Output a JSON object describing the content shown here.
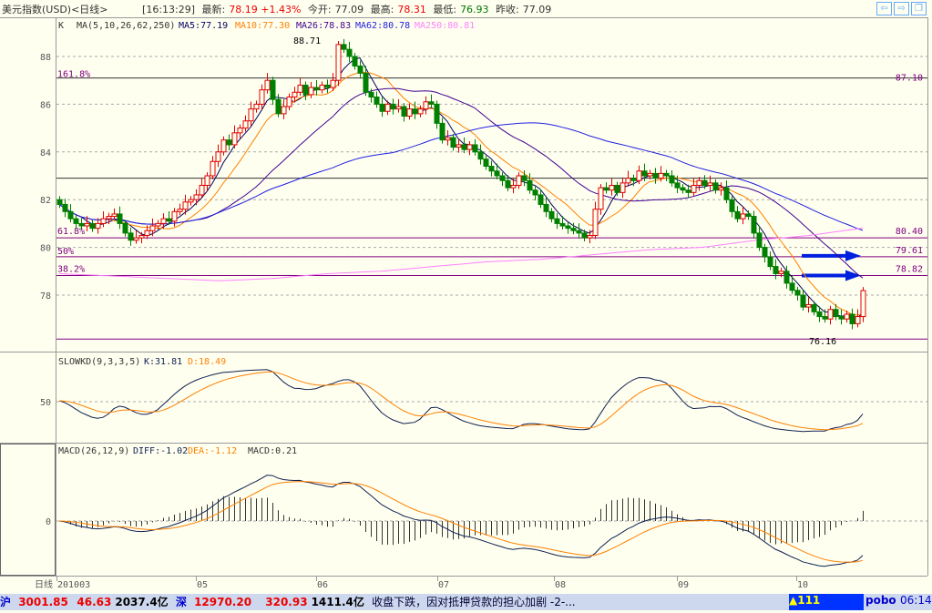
{
  "header": {
    "title": "美元指数(USD)<日线>",
    "time": "[16:13:29]",
    "latest_label": "最新:",
    "latest": "78.19 +1.43%",
    "open_label": "今开:",
    "open": "77.09",
    "high_label": "最高:",
    "high": "78.31",
    "low_label": "最低:",
    "low": "76.93",
    "prev_label": "昨收:",
    "prev": "77.09"
  },
  "nav": {
    "back": "⇦",
    "forward": "⇨",
    "restore": "❐"
  },
  "ma_legend": {
    "k": "K",
    "ma": "MA(5,10,26,62,250)",
    "ma5": "MA5:77.19",
    "ma10": "MA10:77.30",
    "ma26": "MA26:78.83",
    "ma62": "MA62:80.78",
    "ma250": "MA250:80.81"
  },
  "kd_legend": {
    "name": "SLOWKD(9,3,3,5)",
    "k": "K:31.81",
    "d": "D:18.49"
  },
  "macd_legend": {
    "name": "MACD(26,12,9)",
    "diff": "DIFF:-1.02",
    "dea": "DEA:-1.12",
    "macd": "MACD:0.21"
  },
  "axis": {
    "period": "日线",
    "y_ticks": [
      "88",
      "86",
      "84",
      "82",
      "80",
      "78"
    ],
    "kd_tick": "50",
    "macd_tick": "0",
    "months": [
      "201003",
      "05",
      "06",
      "07",
      "08",
      "09",
      "10"
    ]
  },
  "fib": [
    {
      "pct": "161.8%",
      "value": "87.10"
    },
    {
      "pct": "61.8%",
      "value": "80.40"
    },
    {
      "pct": "50%",
      "value": "79.61"
    },
    {
      "pct": "38.2%",
      "value": "78.82"
    }
  ],
  "annotations": {
    "high": "88.71",
    "low": "76.16"
  },
  "colors": {
    "up": "#e00000",
    "down": "#008000",
    "ma5": "#000060",
    "ma10": "#ff8000",
    "ma26": "#400090",
    "ma62": "#2020e0",
    "ma250": "#ff80ff",
    "k": "#102050",
    "d": "#ff8000"
  },
  "chart_data": {
    "type": "candlestick",
    "ylim": [
      75.5,
      89.5
    ],
    "support_level": 82.9,
    "low_level": 76.16,
    "close": [
      81.8,
      81.5,
      81.2,
      81.0,
      80.9,
      81.0,
      80.8,
      81.0,
      81.2,
      81.3,
      81.4,
      81.0,
      80.6,
      80.3,
      80.4,
      80.5,
      80.7,
      80.9,
      81.0,
      81.2,
      81.1,
      81.5,
      81.6,
      81.9,
      82.0,
      82.2,
      82.6,
      83.0,
      83.6,
      84.0,
      84.5,
      84.3,
      84.8,
      85.0,
      85.3,
      85.8,
      86.0,
      86.6,
      87.0,
      86.2,
      85.6,
      85.9,
      86.3,
      86.5,
      86.8,
      86.4,
      86.7,
      86.6,
      86.8,
      86.7,
      87.0,
      88.5,
      88.3,
      88.0,
      87.6,
      87.3,
      86.5,
      86.3,
      86.0,
      85.7,
      86.0,
      85.8,
      85.9,
      85.5,
      85.8,
      85.6,
      85.8,
      86.1,
      86.0,
      85.2,
      84.5,
      84.6,
      84.2,
      84.3,
      84.1,
      84.3,
      84.0,
      83.7,
      83.4,
      83.2,
      83.0,
      82.8,
      82.5,
      82.6,
      83.0,
      82.8,
      82.4,
      82.2,
      81.8,
      81.5,
      81.2,
      81.0,
      80.9,
      80.8,
      80.7,
      80.6,
      80.4,
      80.5,
      81.6,
      82.5,
      82.4,
      82.6,
      82.3,
      82.7,
      82.9,
      82.8,
      83.2,
      83.0,
      83.1,
      82.9,
      83.1,
      83.0,
      82.7,
      82.5,
      82.4,
      82.3,
      82.6,
      82.8,
      82.6,
      82.7,
      82.4,
      82.5,
      82.0,
      81.5,
      81.2,
      81.4,
      81.3,
      80.6,
      80.0,
      79.6,
      79.2,
      78.9,
      79.0,
      78.5,
      78.2,
      78.0,
      77.5,
      77.6,
      77.3,
      77.1,
      77.0,
      77.4,
      77.1,
      77.0,
      77.2,
      76.8,
      77.1,
      78.19
    ],
    "ma250": [
      78.9,
      78.8,
      78.7,
      78.6,
      78.7,
      78.9,
      79.0,
      79.2,
      79.4,
      79.5,
      79.7,
      79.9,
      80.0,
      80.3,
      80.5,
      80.81
    ]
  },
  "status": {
    "sh_label": "沪",
    "sh_index": "3001.85",
    "sh_change": "46.63",
    "sh_amount": "2037.4亿",
    "sz_label": "深",
    "sz_index": "12970.20",
    "sz_change": "320.93",
    "sz_amount": "1411.4亿",
    "news": "收盘下跌，因对抵押贷款的担心加剧 -2-...",
    "alert": "▲111",
    "brand": "pobo",
    "clock": "06:14"
  }
}
